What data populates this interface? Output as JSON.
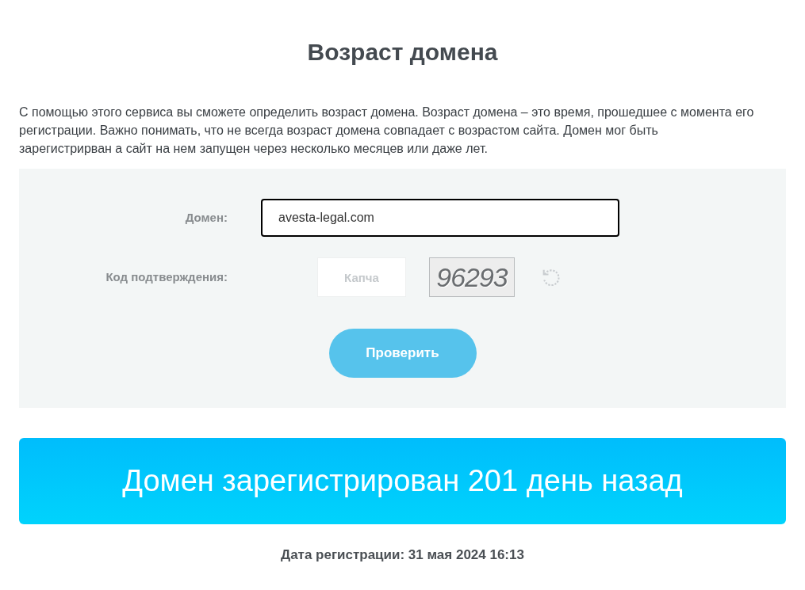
{
  "title": "Возраст домена",
  "description": "С помощью этого сервиса вы сможете определить возраст домена. Возраст домена – это время, прошедшее с момента его регистрации. Важно понимать, что не всегда возраст домена совпадает с возрастом сайта. Домен мог быть зарегистрирван а сайт на нем запущен через несколько месяцев или даже лет.",
  "form": {
    "domain_label": "Домен:",
    "domain_value": "avesta-legal.com",
    "captcha_label": "Код подтверждения:",
    "captcha_placeholder": "Капча",
    "captcha_image_text": "96293",
    "submit": "Проверить"
  },
  "result": {
    "headline": "Домен зарегистрирован 201 день назад",
    "registration_date": "Дата регистрации: 31 мая 2024 16:13"
  }
}
